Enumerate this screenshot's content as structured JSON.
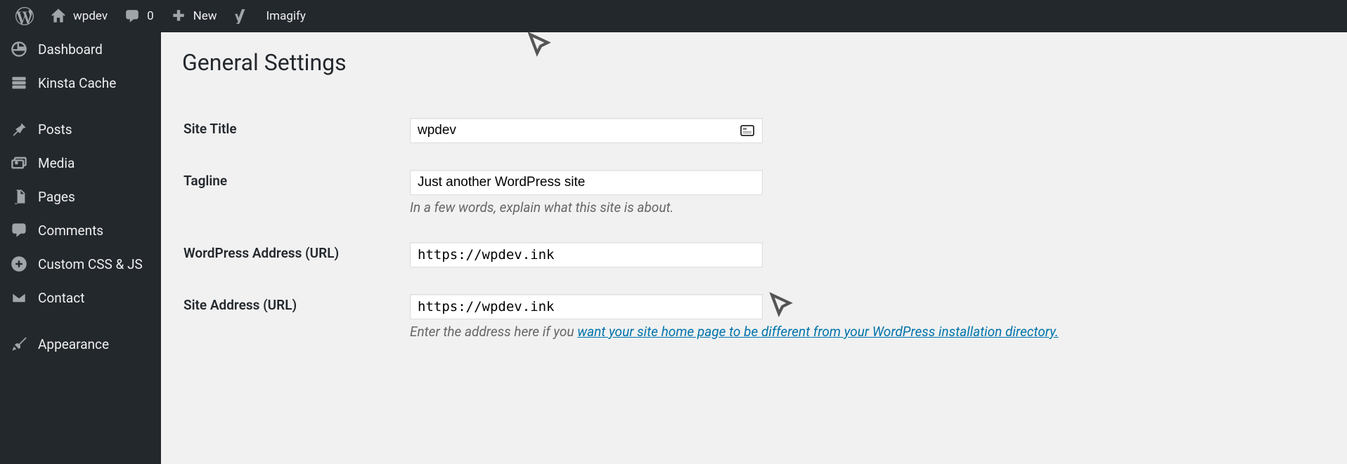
{
  "adminbar": {
    "site_name": "wpdev",
    "comments_count": "0",
    "new_label": "New",
    "imagify_label": "Imagify"
  },
  "sidebar": {
    "items": [
      {
        "label": "Dashboard",
        "icon": "dashboard"
      },
      {
        "label": "Kinsta Cache",
        "icon": "cache"
      },
      {
        "sep": true
      },
      {
        "label": "Posts",
        "icon": "pin"
      },
      {
        "label": "Media",
        "icon": "media"
      },
      {
        "label": "Pages",
        "icon": "pages"
      },
      {
        "label": "Comments",
        "icon": "comment"
      },
      {
        "label": "Custom CSS & JS",
        "icon": "plus-circle"
      },
      {
        "label": "Contact",
        "icon": "envelope"
      },
      {
        "sep": true
      },
      {
        "label": "Appearance",
        "icon": "brush"
      }
    ]
  },
  "page": {
    "title": "General Settings",
    "fields": {
      "site_title": {
        "label": "Site Title",
        "value": "wpdev"
      },
      "tagline": {
        "label": "Tagline",
        "value": "Just another WordPress site",
        "hint": "In a few words, explain what this site is about."
      },
      "wp_url": {
        "label": "WordPress Address (URL)",
        "value": "https://wpdev.ink"
      },
      "site_url": {
        "label": "Site Address (URL)",
        "value": "https://wpdev.ink",
        "hint_pre": "Enter the address here if you ",
        "hint_link": "want your site home page to be different from your WordPress installation directory."
      }
    }
  }
}
